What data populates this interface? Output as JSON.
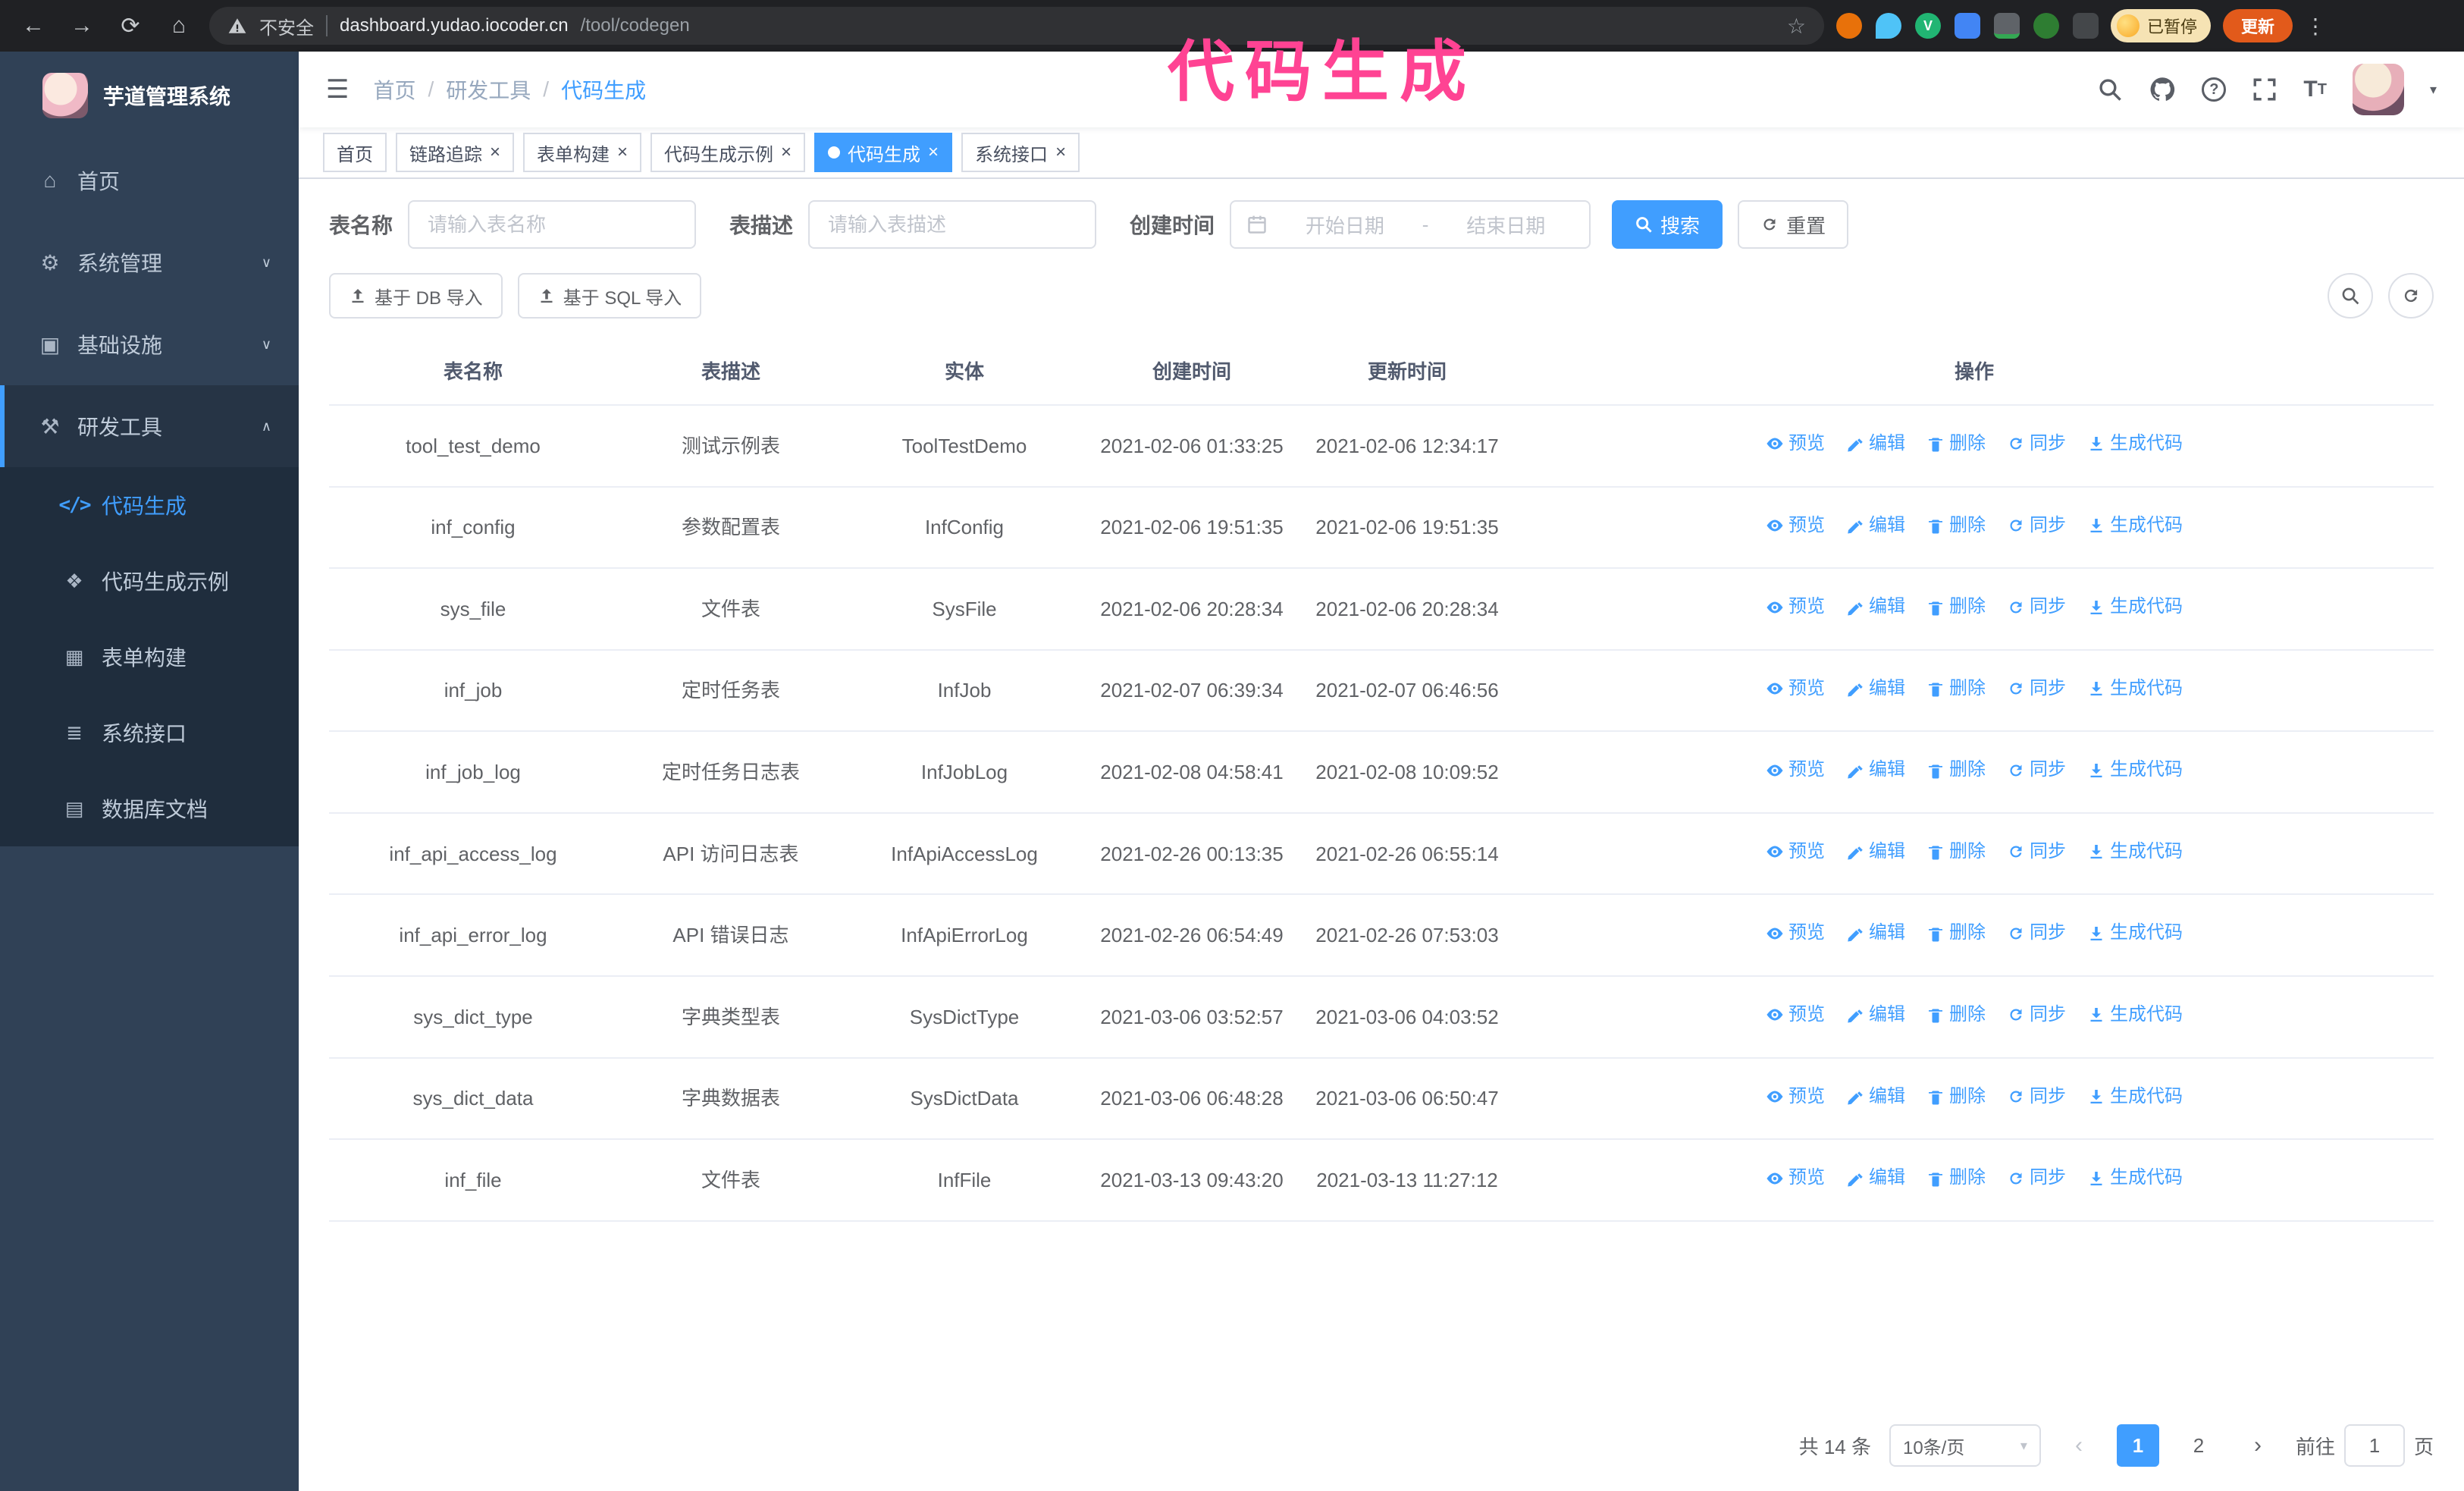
{
  "annotation": {
    "text": "代码生成"
  },
  "browser": {
    "security_label": "不安全",
    "url_host": "dashboard.yudao.iocoder.cn",
    "url_path": "/tool/codegen",
    "paused_badge": "已暂停",
    "update_button": "更新"
  },
  "icons": {
    "back": "←",
    "forward": "→",
    "reload": "⟳",
    "home": "⌂",
    "star": "☆",
    "kebab": "⋮",
    "hamburger": "☰",
    "caret_down": "▾",
    "close": "×",
    "chev_down": "∨",
    "chev_up": "∧",
    "menu_home": "⌂",
    "menu_system": "⚙",
    "menu_infra": "▣",
    "menu_tools": "⚒",
    "menu_code": "</>",
    "menu_example": "❖",
    "menu_form": "▦",
    "menu_api": "≣",
    "menu_db": "▤",
    "prev": "‹",
    "next": "›"
  },
  "colors": {
    "accent": "#409eff",
    "sidebar": "#304156",
    "submenu": "#1f2d3d",
    "annotation": "#ff4393"
  },
  "sidebar": {
    "logo_title": "芋道管理系统",
    "items": [
      {
        "label": "首页"
      },
      {
        "label": "系统管理"
      },
      {
        "label": "基础设施"
      },
      {
        "label": "研发工具"
      }
    ],
    "submenu": [
      {
        "label": "代码生成"
      },
      {
        "label": "代码生成示例"
      },
      {
        "label": "表单构建"
      },
      {
        "label": "系统接口"
      },
      {
        "label": "数据库文档"
      }
    ]
  },
  "navbar": {
    "breadcrumb": [
      "首页",
      "研发工具",
      "代码生成"
    ]
  },
  "tabs": [
    {
      "label": "首页"
    },
    {
      "label": "链路追踪"
    },
    {
      "label": "表单构建"
    },
    {
      "label": "代码生成示例"
    },
    {
      "label": "代码生成"
    },
    {
      "label": "系统接口"
    }
  ],
  "filters": {
    "table_name_label": "表名称",
    "table_name_placeholder": "请输入表名称",
    "table_desc_label": "表描述",
    "table_desc_placeholder": "请输入表描述",
    "create_time_label": "创建时间",
    "date_start_placeholder": "开始日期",
    "date_separator": "-",
    "date_end_placeholder": "结束日期",
    "search_button": "搜索",
    "reset_button": "重置"
  },
  "toolbar": {
    "import_db": "基于 DB 导入",
    "import_sql": "基于 SQL 导入"
  },
  "table": {
    "columns": [
      "表名称",
      "表描述",
      "实体",
      "创建时间",
      "更新时间",
      "操作"
    ],
    "actions": [
      {
        "name": "preview-action",
        "label": "预览",
        "icon": "eye-icon"
      },
      {
        "name": "edit-action",
        "label": "编辑",
        "icon": "edit-icon"
      },
      {
        "name": "delete-action",
        "label": "删除",
        "icon": "delete-icon"
      },
      {
        "name": "sync-action",
        "label": "同步",
        "icon": "sync-icon"
      },
      {
        "name": "generate-code-action",
        "label": "生成代码",
        "icon": "generate-icon"
      }
    ],
    "rows": [
      {
        "name": "tool_test_demo",
        "desc": "测试示例表",
        "entity": "ToolTestDemo",
        "created": "2021-02-06 01:33:25",
        "updated": "2021-02-06 12:34:17"
      },
      {
        "name": "inf_config",
        "desc": "参数配置表",
        "entity": "InfConfig",
        "created": "2021-02-06 19:51:35",
        "updated": "2021-02-06 19:51:35"
      },
      {
        "name": "sys_file",
        "desc": "文件表",
        "entity": "SysFile",
        "created": "2021-02-06 20:28:34",
        "updated": "2021-02-06 20:28:34"
      },
      {
        "name": "inf_job",
        "desc": "定时任务表",
        "entity": "InfJob",
        "created": "2021-02-07 06:39:34",
        "updated": "2021-02-07 06:46:56"
      },
      {
        "name": "inf_job_log",
        "desc": "定时任务日志表",
        "entity": "InfJobLog",
        "created": "2021-02-08 04:58:41",
        "updated": "2021-02-08 10:09:52"
      },
      {
        "name": "inf_api_access_log",
        "desc": "API 访问日志表",
        "entity": "InfApiAccessLog",
        "created": "2021-02-26 00:13:35",
        "updated": "2021-02-26 06:55:14"
      },
      {
        "name": "inf_api_error_log",
        "desc": "API 错误日志",
        "entity": "InfApiErrorLog",
        "created": "2021-02-26 06:54:49",
        "updated": "2021-02-26 07:53:03"
      },
      {
        "name": "sys_dict_type",
        "desc": "字典类型表",
        "entity": "SysDictType",
        "created": "2021-03-06 03:52:57",
        "updated": "2021-03-06 04:03:52"
      },
      {
        "name": "sys_dict_data",
        "desc": "字典数据表",
        "entity": "SysDictData",
        "created": "2021-03-06 06:48:28",
        "updated": "2021-03-06 06:50:47"
      },
      {
        "name": "inf_file",
        "desc": "文件表",
        "entity": "InfFile",
        "created": "2021-03-13 09:43:20",
        "updated": "2021-03-13 11:27:12"
      }
    ]
  },
  "pagination": {
    "total_text": "共 14 条",
    "page_size": "10条/页",
    "pages": [
      "1",
      "2"
    ],
    "active_page": "1",
    "goto_label": "前往",
    "goto_value": "1",
    "goto_suffix": "页"
  }
}
